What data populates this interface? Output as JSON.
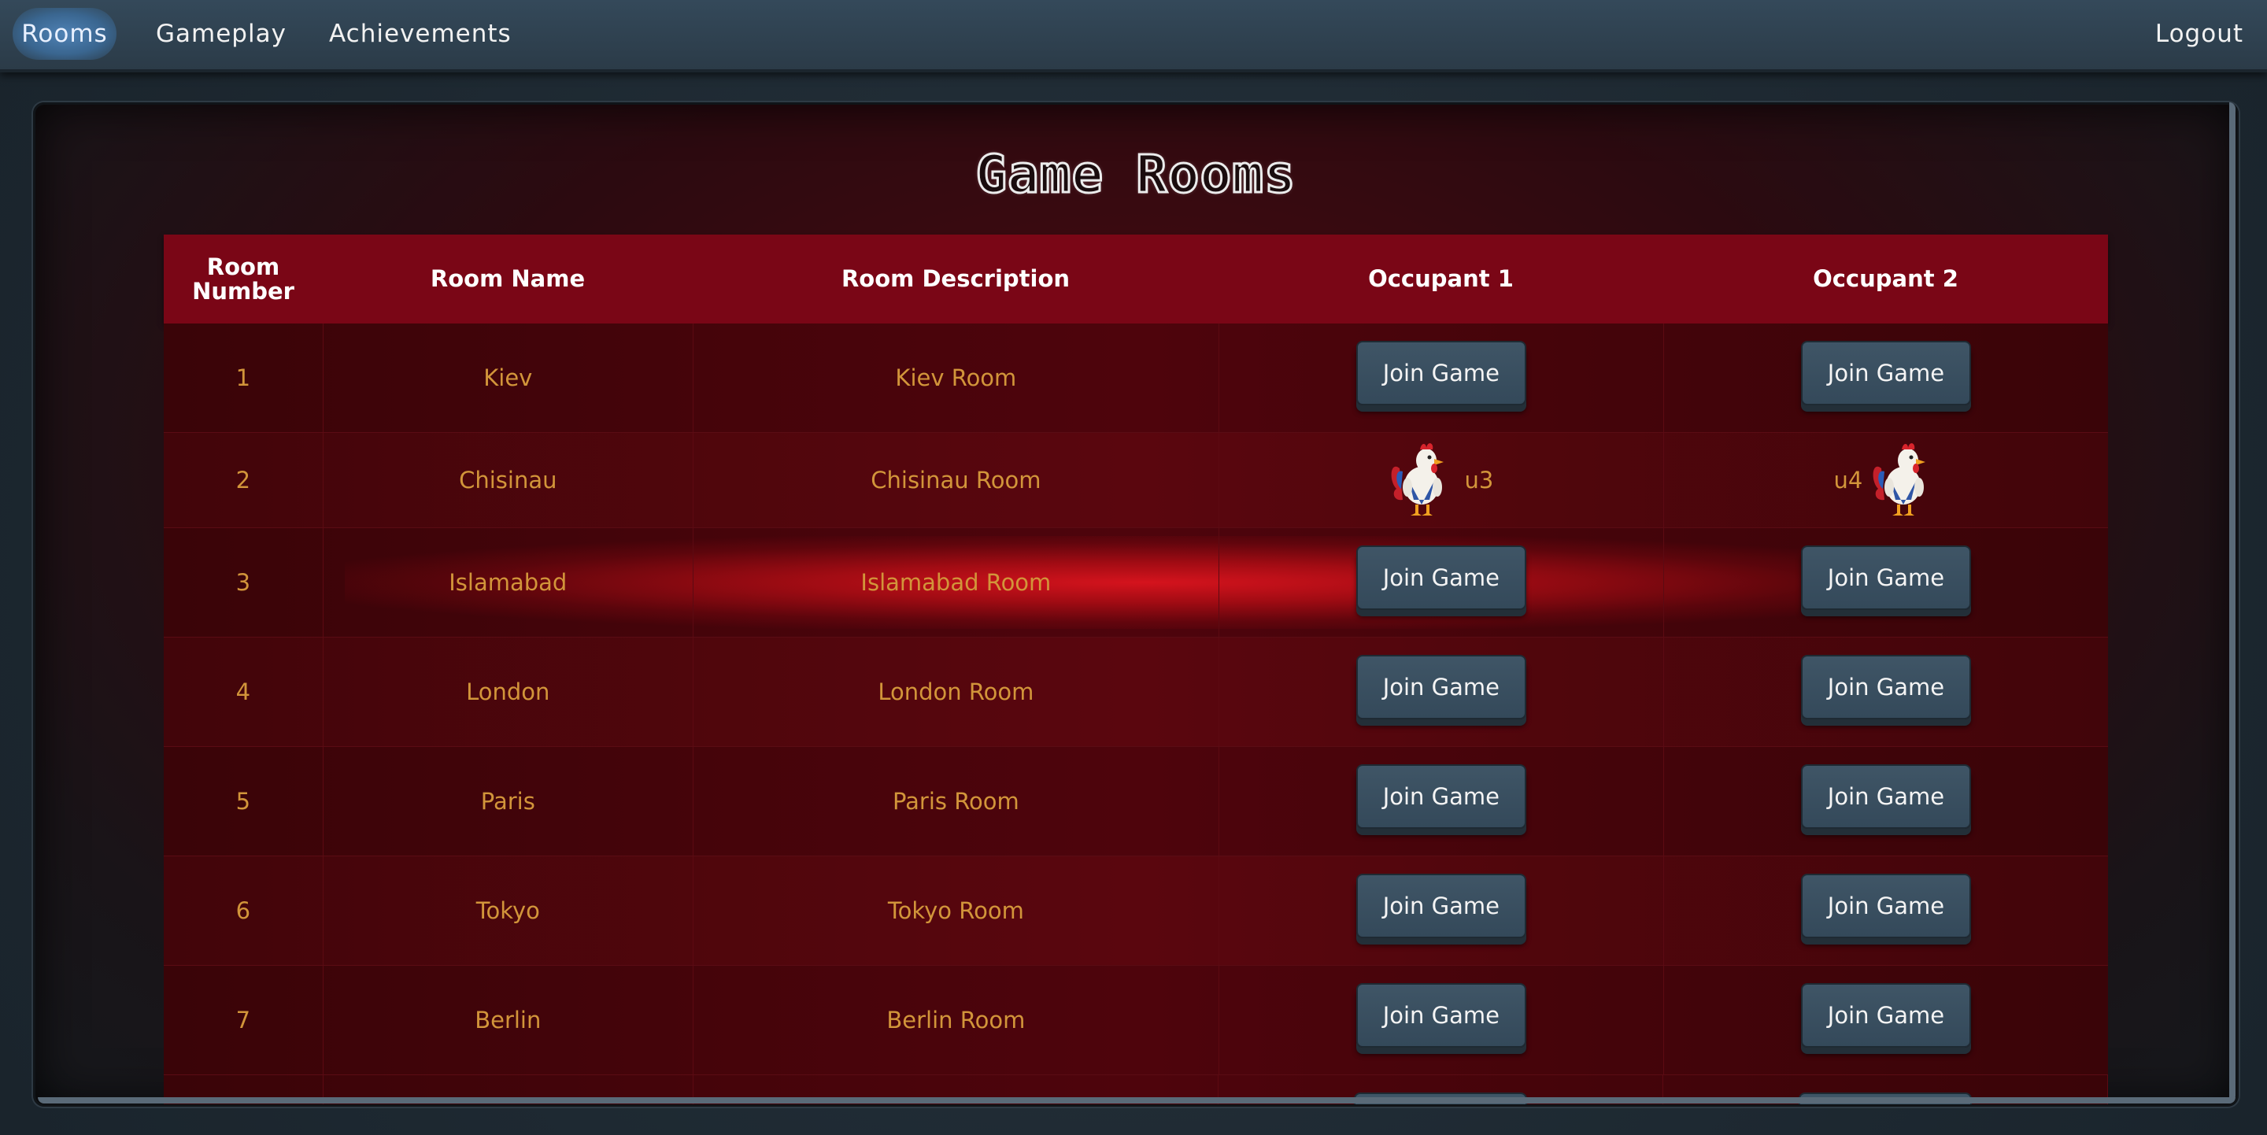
{
  "nav": {
    "rooms": "Rooms",
    "gameplay": "Gameplay",
    "achievements": "Achievements",
    "logout": "Logout"
  },
  "page": {
    "title": "Game Rooms"
  },
  "table": {
    "headers": [
      "Room\nNumber",
      "Room Name",
      "Room Description",
      "Occupant 1",
      "Occupant 2"
    ],
    "join_label": "Join Game",
    "rows": [
      {
        "number": "1",
        "name": "Kiev",
        "description": "Kiev Room",
        "occ1": "",
        "occ2": ""
      },
      {
        "number": "2",
        "name": "Chisinau",
        "description": "Chisinau Room",
        "occ1": "u3",
        "occ2": "u4"
      },
      {
        "number": "3",
        "name": "Islamabad",
        "description": "Islamabad Room",
        "occ1": "",
        "occ2": ""
      },
      {
        "number": "4",
        "name": "London",
        "description": "London Room",
        "occ1": "",
        "occ2": ""
      },
      {
        "number": "5",
        "name": "Paris",
        "description": "Paris Room",
        "occ1": "",
        "occ2": ""
      },
      {
        "number": "6",
        "name": "Tokyo",
        "description": "Tokyo Room",
        "occ1": "",
        "occ2": ""
      },
      {
        "number": "7",
        "name": "Berlin",
        "description": "Berlin Room",
        "occ1": "",
        "occ2": ""
      }
    ]
  },
  "colors": {
    "nav_bg": "#34495a",
    "header_bg": "#7a0616",
    "row_text": "#d2953a",
    "button_bg": "#3f5566",
    "highlight_glow": "#dc141e"
  },
  "icons": {
    "avatar": "rooster-avatar-icon"
  }
}
